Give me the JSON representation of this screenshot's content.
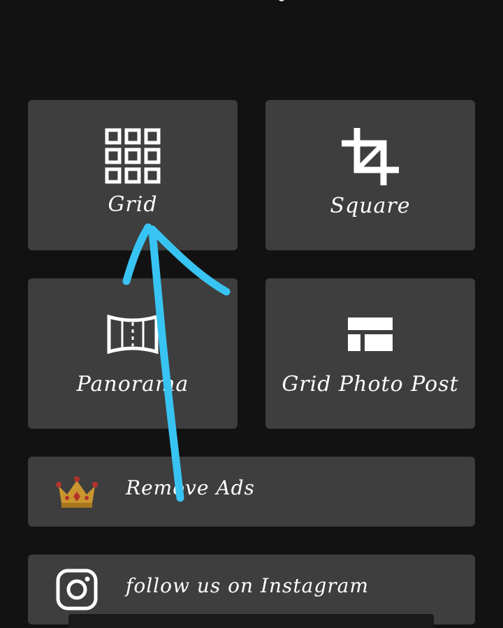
{
  "tiles": {
    "grid": {
      "label": "Grid",
      "icon": "grid-icon"
    },
    "square": {
      "label": "Square",
      "icon": "crop-icon"
    },
    "panorama": {
      "label": "Panorama",
      "icon": "panorama-icon"
    },
    "grid_photo_post": {
      "label": "Grid Photo Post",
      "icon": "layout-icon"
    }
  },
  "rows": {
    "remove_ads": {
      "label": "Remove Ads",
      "icon": "crown-icon"
    },
    "instagram": {
      "label": "follow us on Instagram",
      "icon": "instagram-icon"
    }
  },
  "colors": {
    "background": "#121212",
    "tile": "#3e3e3e",
    "text": "#ffffff",
    "annotation_arrow": "#38c4f2",
    "crown_gold": "#c9952d",
    "crown_red": "#b3322c"
  },
  "annotation": {
    "icon": "arrow-annotation-icon"
  }
}
